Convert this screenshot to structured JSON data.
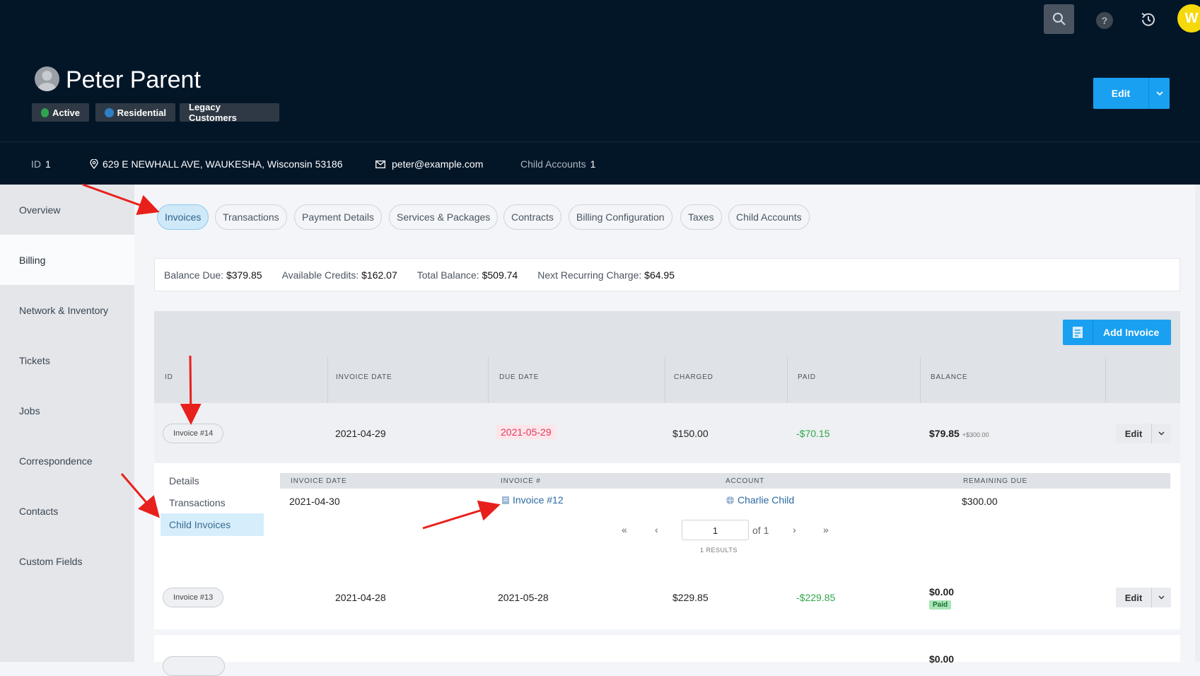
{
  "profile": {
    "name": "Peter Parent",
    "tags": [
      {
        "label": "Active",
        "color": "#2ea44f"
      },
      {
        "label": "Residential",
        "color": "#2f7fc4"
      },
      {
        "label": "Legacy Customers"
      }
    ],
    "edit_label": "Edit"
  },
  "info": {
    "id_label": "ID",
    "id_value": "1",
    "address": "629 E NEWHALL AVE, WAUKESHA, Wisconsin 53186",
    "email": "peter@example.com",
    "child_label": "Child Accounts",
    "child_value": "1"
  },
  "topbar": {
    "avatar_letter": "W",
    "help_glyph": "?"
  },
  "sidebar": {
    "items": [
      "Overview",
      "Billing",
      "Network & Inventory",
      "Tickets",
      "Jobs",
      "Correspondence",
      "Contacts",
      "Custom Fields"
    ],
    "active": "Billing"
  },
  "tabs": [
    "Invoices",
    "Transactions",
    "Payment Details",
    "Services & Packages",
    "Contracts",
    "Billing Configuration",
    "Taxes",
    "Child Accounts"
  ],
  "balances": {
    "balance_due_label": "Balance Due:",
    "balance_due": "$379.85",
    "credits_label": "Available Credits:",
    "credits": "$162.07",
    "total_label": "Total Balance:",
    "total": "$509.74",
    "next_label": "Next Recurring Charge:",
    "next": "$64.95"
  },
  "add_invoice_label": "Add Invoice",
  "table": {
    "headers": [
      "ID",
      "INVOICE DATE",
      "DUE DATE",
      "CHARGED",
      "PAID",
      "BALANCE"
    ],
    "rows": [
      {
        "id": "Invoice #14",
        "invoice_date": "2021-04-29",
        "due_date": "2021-05-29",
        "charged": "$150.00",
        "paid": "-$70.15",
        "balance": "$79.85",
        "balance_extra": "+$300.00",
        "edit": "Edit"
      },
      {
        "id": "Invoice #13",
        "invoice_date": "2021-04-28",
        "due_date": "2021-05-28",
        "charged": "$229.85",
        "paid": "-$229.85",
        "balance": "$0.00",
        "badge": "Paid",
        "edit": "Edit"
      },
      {
        "balance": "$0.00"
      }
    ]
  },
  "subpanel": {
    "nav": [
      "Details",
      "Transactions",
      "Child Invoices"
    ],
    "active": "Child Invoices",
    "headers": [
      "INVOICE DATE",
      "INVOICE #",
      "ACCOUNT",
      "REMAINING DUE"
    ],
    "row": {
      "invoice_date": "2021-04-30",
      "invoice_no": "Invoice #12",
      "account": "Charlie Child",
      "remaining_due": "$300.00"
    },
    "pager": {
      "first": "«",
      "prev": "‹",
      "page": "1",
      "of": "of 1",
      "next": "›",
      "last": "»",
      "results": "1 RESULTS"
    }
  }
}
